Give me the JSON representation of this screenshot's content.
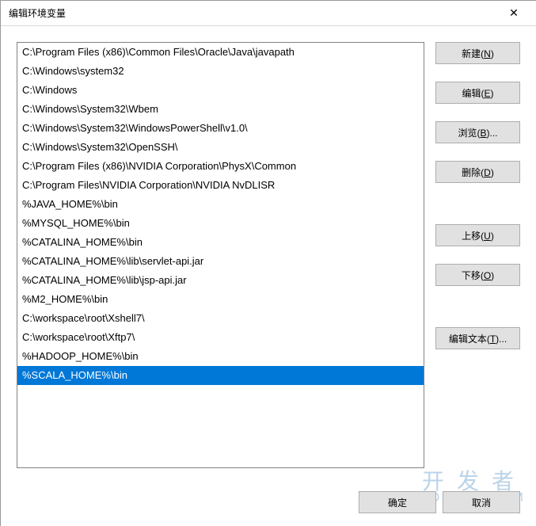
{
  "window": {
    "title": "编辑环境变量",
    "close_glyph": "✕"
  },
  "list": {
    "items": [
      "C:\\Program Files (x86)\\Common Files\\Oracle\\Java\\javapath",
      "C:\\Windows\\system32",
      "C:\\Windows",
      "C:\\Windows\\System32\\Wbem",
      "C:\\Windows\\System32\\WindowsPowerShell\\v1.0\\",
      "C:\\Windows\\System32\\OpenSSH\\",
      "C:\\Program Files (x86)\\NVIDIA Corporation\\PhysX\\Common",
      "C:\\Program Files\\NVIDIA Corporation\\NVIDIA NvDLISR",
      "%JAVA_HOME%\\bin",
      "%MYSQL_HOME%\\bin",
      "%CATALINA_HOME%\\bin",
      "%CATALINA_HOME%\\lib\\servlet-api.jar",
      "%CATALINA_HOME%\\lib\\jsp-api.jar",
      "%M2_HOME%\\bin",
      "C:\\workspace\\root\\Xshell7\\",
      "C:\\workspace\\root\\Xftp7\\",
      "%HADOOP_HOME%\\bin",
      "%SCALA_HOME%\\bin"
    ],
    "selected_index": 17
  },
  "buttons": {
    "new": {
      "label": "新建",
      "accel": "N"
    },
    "edit": {
      "label": "编辑",
      "accel": "E"
    },
    "browse": {
      "label": "浏览",
      "accel": "B",
      "suffix": "..."
    },
    "delete": {
      "label": "删除",
      "accel": "D"
    },
    "move_up": {
      "label": "上移",
      "accel": "U"
    },
    "move_down": {
      "label": "下移",
      "accel": "O"
    },
    "edit_text": {
      "label": "编辑文本",
      "accel": "T",
      "suffix": "..."
    },
    "ok": {
      "label": "确定"
    },
    "cancel": {
      "label": "取消"
    }
  },
  "watermark": {
    "line1": "开发者",
    "line2": "DevZe.CoM"
  }
}
